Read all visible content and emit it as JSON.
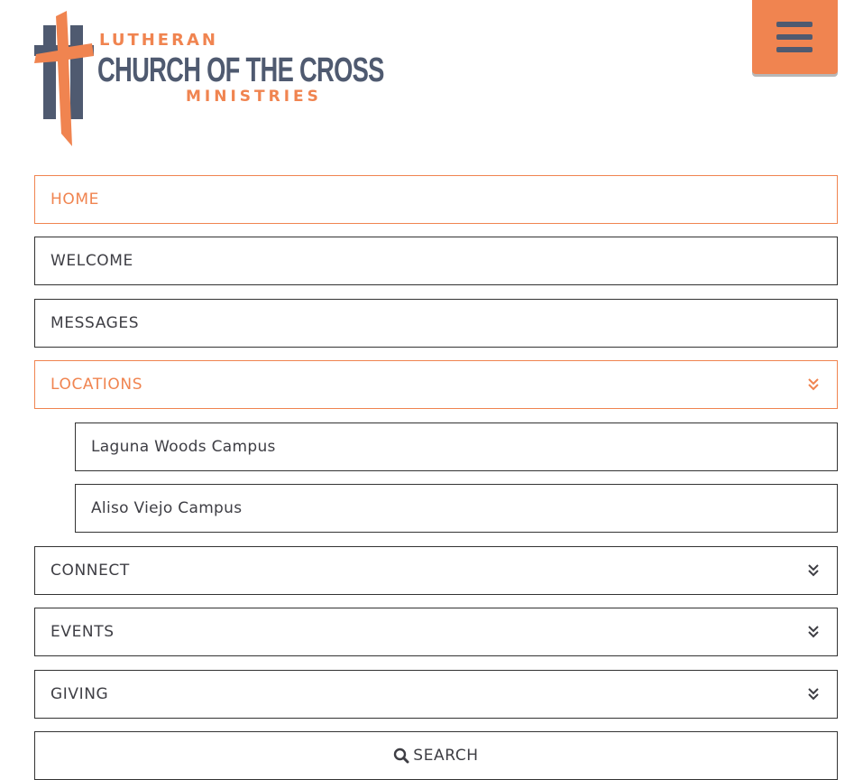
{
  "logo": {
    "line1": "LUTHERAN",
    "line2": "CHURCH OF THE CROSS",
    "line3": "MINISTRIES",
    "icon": "cross-logo-icon"
  },
  "header": {
    "menu_icon": "hamburger-icon"
  },
  "colors": {
    "accent": "#f08450",
    "slate": "#4f5a70",
    "text": "#3e3e44",
    "border": "#333333"
  },
  "nav": {
    "home": "HOME",
    "welcome": "WELCOME",
    "messages": "MESSAGES",
    "locations": "LOCATIONS",
    "laguna": "Laguna Woods Campus",
    "aliso": "Aliso Viejo Campus",
    "connect": "CONNECT",
    "events": "EVENTS",
    "giving": "GIVING",
    "search": "SEARCH"
  }
}
